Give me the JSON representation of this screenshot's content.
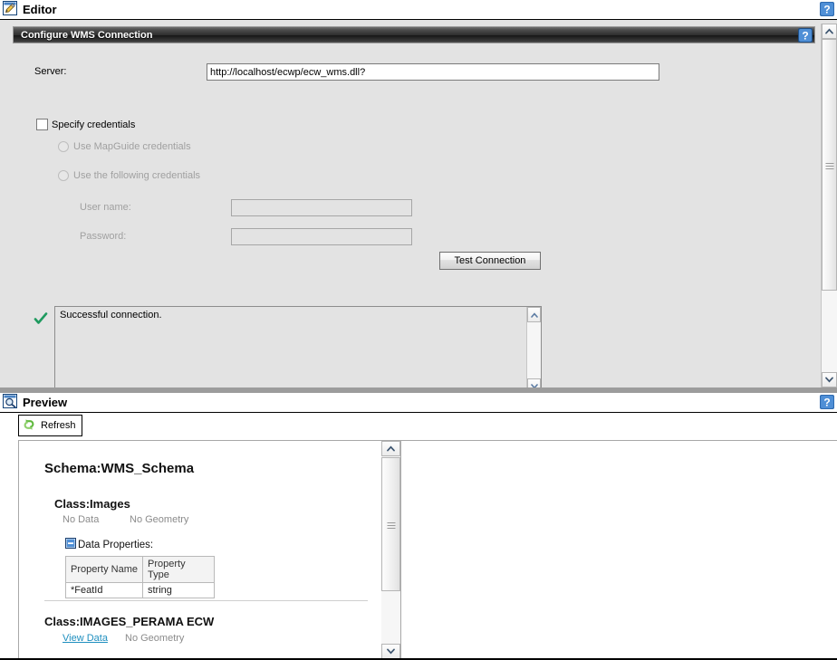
{
  "editor": {
    "title": "Editor",
    "icon": "editor-pencil-icon",
    "help_icon": "help-question-icon",
    "group": {
      "caption": "Configure WMS Connection",
      "help_icon": "help-question-icon"
    },
    "fields": {
      "server_label": "Server:",
      "server_value": "http://localhost/ecwp/ecw_wms.dll?",
      "server_placeholder": "",
      "specify_credentials_label": "Specify credentials",
      "specify_credentials_checked": false,
      "use_mapguide_label": "Use MapGuide credentials",
      "use_following_label": "Use the following credentials",
      "username_label": "User name:",
      "username_value": "",
      "password_label": "Password:",
      "password_value": ""
    },
    "test_connection_label": "Test Connection",
    "result": {
      "status_icon": "green-check-icon",
      "message": "Successful connection."
    }
  },
  "preview": {
    "title": "Preview",
    "icon": "preview-magnifier-icon",
    "help_icon": "help-question-icon",
    "refresh_label": "Refresh",
    "refresh_icon": "refresh-arrows-icon",
    "schema": {
      "schema_title": "Schema:WMS_Schema",
      "classes": [
        {
          "name": "Class:Images",
          "data_link": "No Data",
          "geometry": "No Geometry",
          "data_properties_label": "Data Properties:",
          "toggle_icon": "collapse-minus-icon",
          "columns": [
            "Property Name",
            "Property Type"
          ],
          "rows": [
            [
              "*FeatId",
              "string"
            ]
          ]
        },
        {
          "name": "Class:IMAGES_PERAMA ECW",
          "data_link": "View Data",
          "geometry": "No Geometry"
        }
      ]
    }
  },
  "scrollbars": {
    "up_glyph": "chevron-up-icon",
    "down_glyph": "chevron-down-icon"
  },
  "colors": {
    "panel_bg": "#e3e3e3",
    "caption_dark": "#2e2e2e",
    "accent_link": "#1f8fbf",
    "success_green": "#1f9a5f",
    "splitter": "#9c9c9c"
  }
}
